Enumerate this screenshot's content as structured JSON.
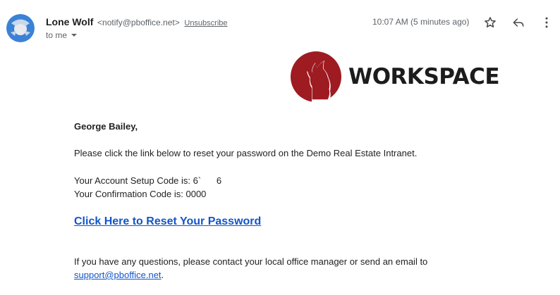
{
  "header": {
    "sender_name": "Lone Wolf",
    "sender_email": "<notify@pboffice.net>",
    "unsubscribe_label": "Unsubscribe",
    "to_label": "to me",
    "timestamp": "10:07 AM (5 minutes ago)",
    "avatar_icon": "user-avatar-icon",
    "icons": [
      "star-icon",
      "reply-icon",
      "more-vert-icon"
    ]
  },
  "logo": {
    "text": "WORKSPACE",
    "mark_icon": "howling-wolf-icon",
    "mark_color": "#9e1b22"
  },
  "message": {
    "greeting": "George Bailey,",
    "intro": "Please click the link below to reset your password on the Demo Real Estate Intranet.",
    "setup_code_label": "Your Account Setup Code is: 6`      6",
    "confirmation_code_label": "Your Confirmation Code is: 0000",
    "reset_link_label": "Click Here to Reset Your Password",
    "questions_text": "If you have any questions, please contact your local office manager or send an email to",
    "support_email": "support@pboffice.net",
    "support_suffix": "."
  },
  "colors": {
    "link": "#1155cc",
    "avatar": "#4285f4",
    "muted": "#5f6368"
  }
}
